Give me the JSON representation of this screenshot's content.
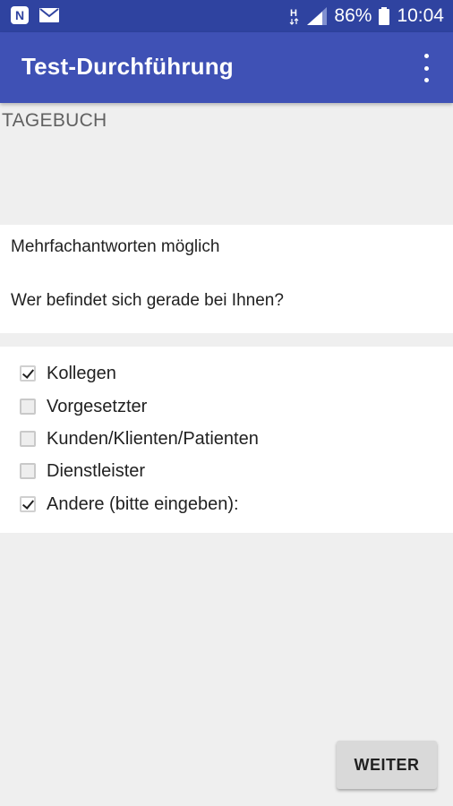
{
  "status_bar": {
    "notification_icons": [
      "n-app-icon",
      "mail-icon"
    ],
    "network_type": "H",
    "battery_percent": "86%",
    "time": "10:04"
  },
  "app_bar": {
    "title": "Test-Durchführung",
    "menu_icon": "more-vert-icon"
  },
  "section": {
    "label": "TAGEBUCH"
  },
  "question": {
    "hint": "Mehrfachantworten möglich",
    "text": "Wer befindet sich gerade bei Ihnen?"
  },
  "options": [
    {
      "label": "Kollegen",
      "checked": true
    },
    {
      "label": "Vorgesetzter",
      "checked": false
    },
    {
      "label": "Kunden/Klienten/Patienten",
      "checked": false
    },
    {
      "label": "Dienstleister",
      "checked": false
    },
    {
      "label": "Andere (bitte eingeben):",
      "checked": true
    }
  ],
  "actions": {
    "next_label": "WEITER"
  },
  "colors": {
    "status_bar": "#2f43a0",
    "app_bar": "#3f51b5",
    "background": "#efefef"
  }
}
